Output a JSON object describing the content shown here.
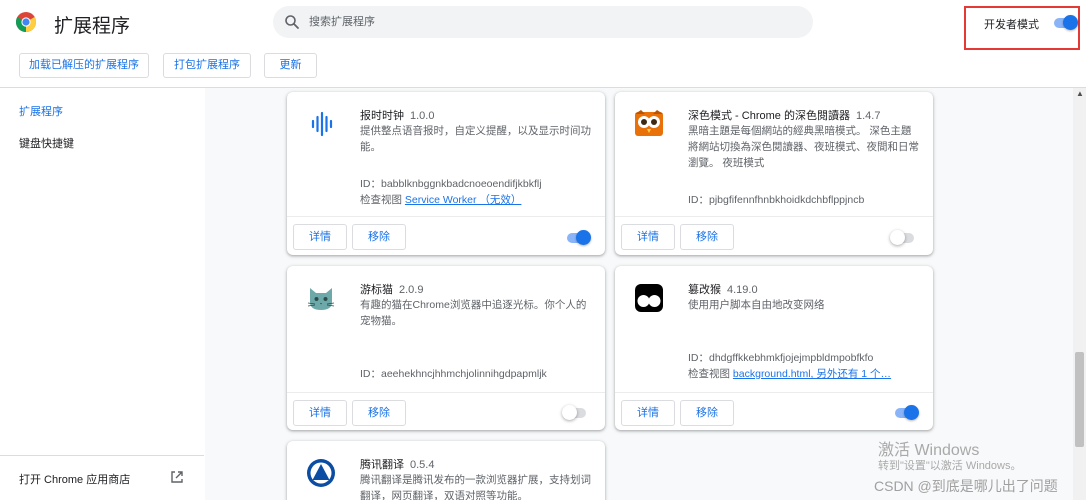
{
  "header": {
    "title": "扩展程序",
    "search_placeholder": "搜索扩展程序",
    "dev_mode_label": "开发者模式",
    "dev_mode_on": true
  },
  "toolbar": {
    "load_unpacked": "加载已解压的扩展程序",
    "pack": "打包扩展程序",
    "update": "更新"
  },
  "sidebar": {
    "items": [
      {
        "label": "扩展程序",
        "active": true
      },
      {
        "label": "键盘快捷键",
        "active": false
      }
    ],
    "store_link": "打开 Chrome 应用商店"
  },
  "card_labels": {
    "details": "详情",
    "remove": "移除",
    "id_prefix": "ID：",
    "inspect_prefix": "检查视图"
  },
  "extensions": [
    {
      "name": "报时时钟",
      "version": "1.0.0",
      "description": "提供整点语音报时，自定义提醒，以及显示时间功能。",
      "id": "babblknbggnkbadcnoeoendifjkbkflj",
      "inspect_link": "Service Worker （无效）",
      "enabled": true,
      "icon": "sound-wave-icon"
    },
    {
      "name": "深色模式 - Chrome 的深色閱讀器",
      "version": "1.4.7",
      "description": "黑暗主題是每個網站的經典黑暗模式。 深色主題將網站切換為深色閱讀器、夜班模式、夜間和日常瀏覽。 夜班模式",
      "id": "pjbgfifennfhnbkhoidkdchbflppjncb",
      "inspect_link": "",
      "enabled": false,
      "icon": "owl-icon"
    },
    {
      "name": "游标猫",
      "version": "2.0.9",
      "description": "有趣的猫在Chrome浏览器中追逐光标。你个人的宠物猫。",
      "id": "aeehekhncjhhmchjolinnihgdpapmljk",
      "inspect_link": "",
      "enabled": false,
      "icon": "cat-icon"
    },
    {
      "name": "篡改猴",
      "version": "4.19.0",
      "description": "使用用户脚本自由地改变网络",
      "id": "dhdgffkkebhmkfjojejmpbldmpobfkfo",
      "inspect_link": "background.html, 另外还有 1 个…",
      "enabled": true,
      "icon": "tampermonkey-icon"
    },
    {
      "name": "腾讯翻译",
      "version": "0.5.4",
      "description": "腾讯翻译是腾讯发布的一款浏览器扩展，支持划词翻译，网页翻译，双语对照等功能。",
      "icon": "tencent-translate-icon"
    }
  ],
  "watermark": {
    "title": "激活 Windows",
    "subtitle": "转到\"设置\"以激活 Windows。",
    "credit": "CSDN @到底是哪儿出了问题"
  },
  "colors": {
    "accent": "#1a73e8",
    "highlight_box": "#e53935",
    "toggle_track_on": "#8ab4f8"
  }
}
